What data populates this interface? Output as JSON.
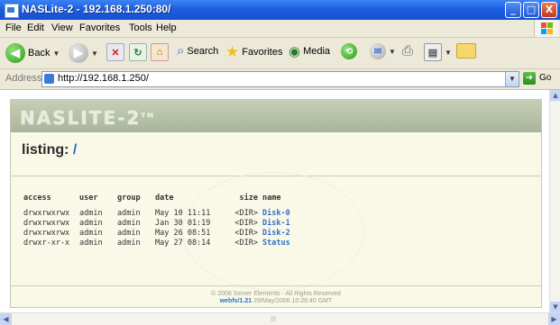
{
  "window": {
    "title": "NASLite-2 - 192.168.1.250:80/",
    "controls": {
      "minimize": "_",
      "maximize": "□",
      "close": "X"
    }
  },
  "menu": {
    "items": [
      "File",
      "Edit",
      "View",
      "Favorites",
      "Tools",
      "Help"
    ]
  },
  "toolbar": {
    "back": "Back",
    "search": "Search",
    "favorites": "Favorites",
    "media": "Media"
  },
  "address": {
    "label": "Address",
    "url": "http://192.168.1.250/",
    "go": "Go"
  },
  "page": {
    "logo": "NASLITE-2",
    "logo_tm": "TM",
    "heading": "listing:",
    "heading_path": "/",
    "columns": [
      "access",
      "user",
      "group",
      "date",
      "size",
      "name"
    ],
    "rows": [
      [
        "drwxrwxrwx",
        "admin",
        "admin",
        "May 10 11:11",
        "<DIR>",
        "Disk-0"
      ],
      [
        "drwxrwxrwx",
        "admin",
        "admin",
        "Jan 30 01:19",
        "<DIR>",
        "Disk-1"
      ],
      [
        "drwxrwxrwx",
        "admin",
        "admin",
        "May 26 08:51",
        "<DIR>",
        "Disk-2"
      ],
      [
        "drwxr-xr-x",
        "admin",
        "admin",
        "May 27 08:14",
        "<DIR>",
        "Status"
      ]
    ],
    "footer_copyright": "© 2006 Server Elements - All Rights Reserved",
    "footer_version": "webfs/1.21",
    "footer_date": "29/May/2006 10:26:40 GMT"
  },
  "colors": {
    "titlebar": "#1d5fe0",
    "link": "#2e6fc7",
    "page_bg": "#faf9e8",
    "banner": "#b5c1a7"
  }
}
